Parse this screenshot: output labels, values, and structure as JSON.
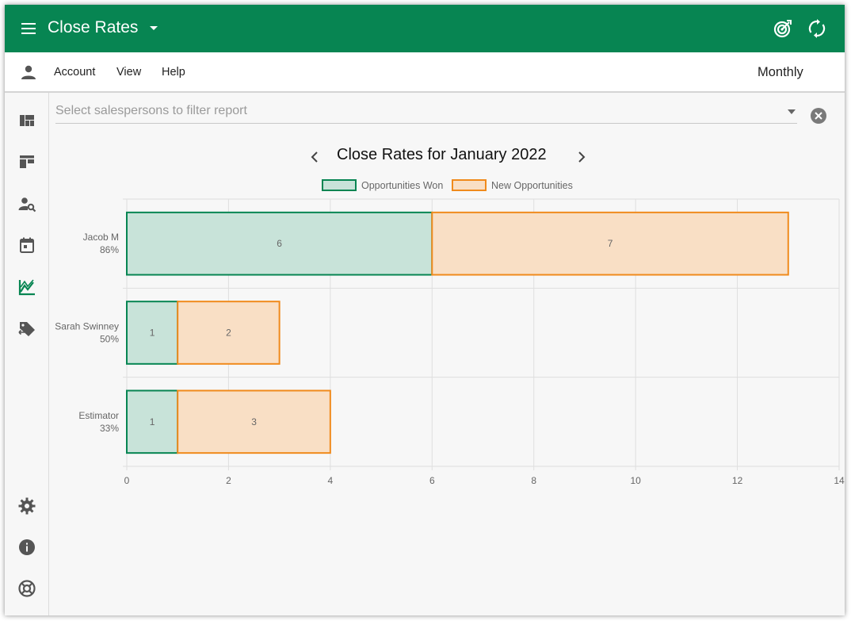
{
  "app": {
    "title": "Close Rates",
    "menu_icon": "menu-icon",
    "title_dropdown_icon": "caret-down-icon",
    "actions": [
      {
        "icon": "target-icon"
      },
      {
        "icon": "sync-icon"
      }
    ],
    "brand_color": "#078552"
  },
  "menubar": {
    "user_icon": "person-icon",
    "items": [
      "Account",
      "View",
      "Help"
    ],
    "period": "Monthly"
  },
  "sidebar": {
    "items": [
      {
        "icon": "dashboard-icon"
      },
      {
        "icon": "board-icon"
      },
      {
        "icon": "person-search-icon"
      },
      {
        "icon": "calendar-icon"
      },
      {
        "icon": "trend-chart-icon",
        "active": true
      },
      {
        "icon": "tag-transfer-icon"
      }
    ],
    "bottom_items": [
      {
        "icon": "settings-icon"
      },
      {
        "icon": "info-icon"
      },
      {
        "icon": "help-lifebuoy-icon"
      }
    ]
  },
  "filter": {
    "placeholder": "Select salespersons to filter report",
    "clear_icon": "clear-circle-icon"
  },
  "report": {
    "title": "Close Rates for January 2022",
    "prev_icon": "chevron-left-icon",
    "next_icon": "chevron-right-icon"
  },
  "chart_data": {
    "type": "bar",
    "orientation": "horizontal",
    "stacked": true,
    "categories": [
      "Jacob M",
      "Sarah Swinney",
      "Estimator"
    ],
    "category_sublabels": [
      "86%",
      "50%",
      "33%"
    ],
    "series": [
      {
        "name": "Opportunities Won",
        "values": [
          6,
          1,
          1
        ],
        "fill": "#c8e3d9",
        "stroke": "#078552"
      },
      {
        "name": "New Opportunities",
        "values": [
          7,
          2,
          3
        ],
        "fill": "#f9dfc5",
        "stroke": "#f08a1c"
      }
    ],
    "xlim": [
      0,
      14
    ],
    "x_ticks": [
      "0",
      "2",
      "4",
      "6",
      "8",
      "10",
      "12",
      "14"
    ],
    "grid": true,
    "legend_position": "top"
  }
}
